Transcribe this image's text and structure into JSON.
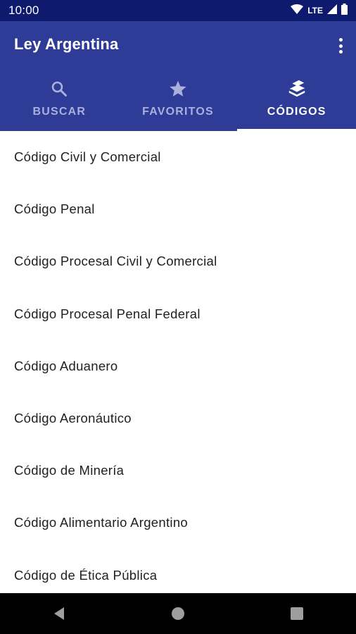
{
  "status_bar": {
    "time": "10:00",
    "network": "LTE",
    "icons": [
      "wifi-icon",
      "signal-icon",
      "battery-icon"
    ]
  },
  "app_bar": {
    "title": "Ley Argentina",
    "menu_icon": "more-vert-icon",
    "background": "#2e3c98"
  },
  "tabs": [
    {
      "label": "BUSCAR",
      "icon": "search-icon",
      "active": false
    },
    {
      "label": "FAVORITOS",
      "icon": "star-icon",
      "active": false
    },
    {
      "label": "CÓDIGOS",
      "icon": "book-stack-icon",
      "active": true
    }
  ],
  "codes": [
    "Código Civil y Comercial",
    "Código Penal",
    "Código Procesal Civil y Comercial",
    "Código Procesal Penal Federal",
    "Código Aduanero",
    "Código Aeronáutico",
    "Código de Minería",
    "Código Alimentario Argentino",
    "Código de Ética Pública"
  ],
  "nav_bar": {
    "buttons": [
      "back-icon",
      "home-icon",
      "recents-icon"
    ]
  },
  "colors": {
    "status_bar": "#0e1a6e",
    "app_bar": "#2e3c98",
    "tab_inactive": "#a9b0dc",
    "tab_active": "#ffffff"
  }
}
